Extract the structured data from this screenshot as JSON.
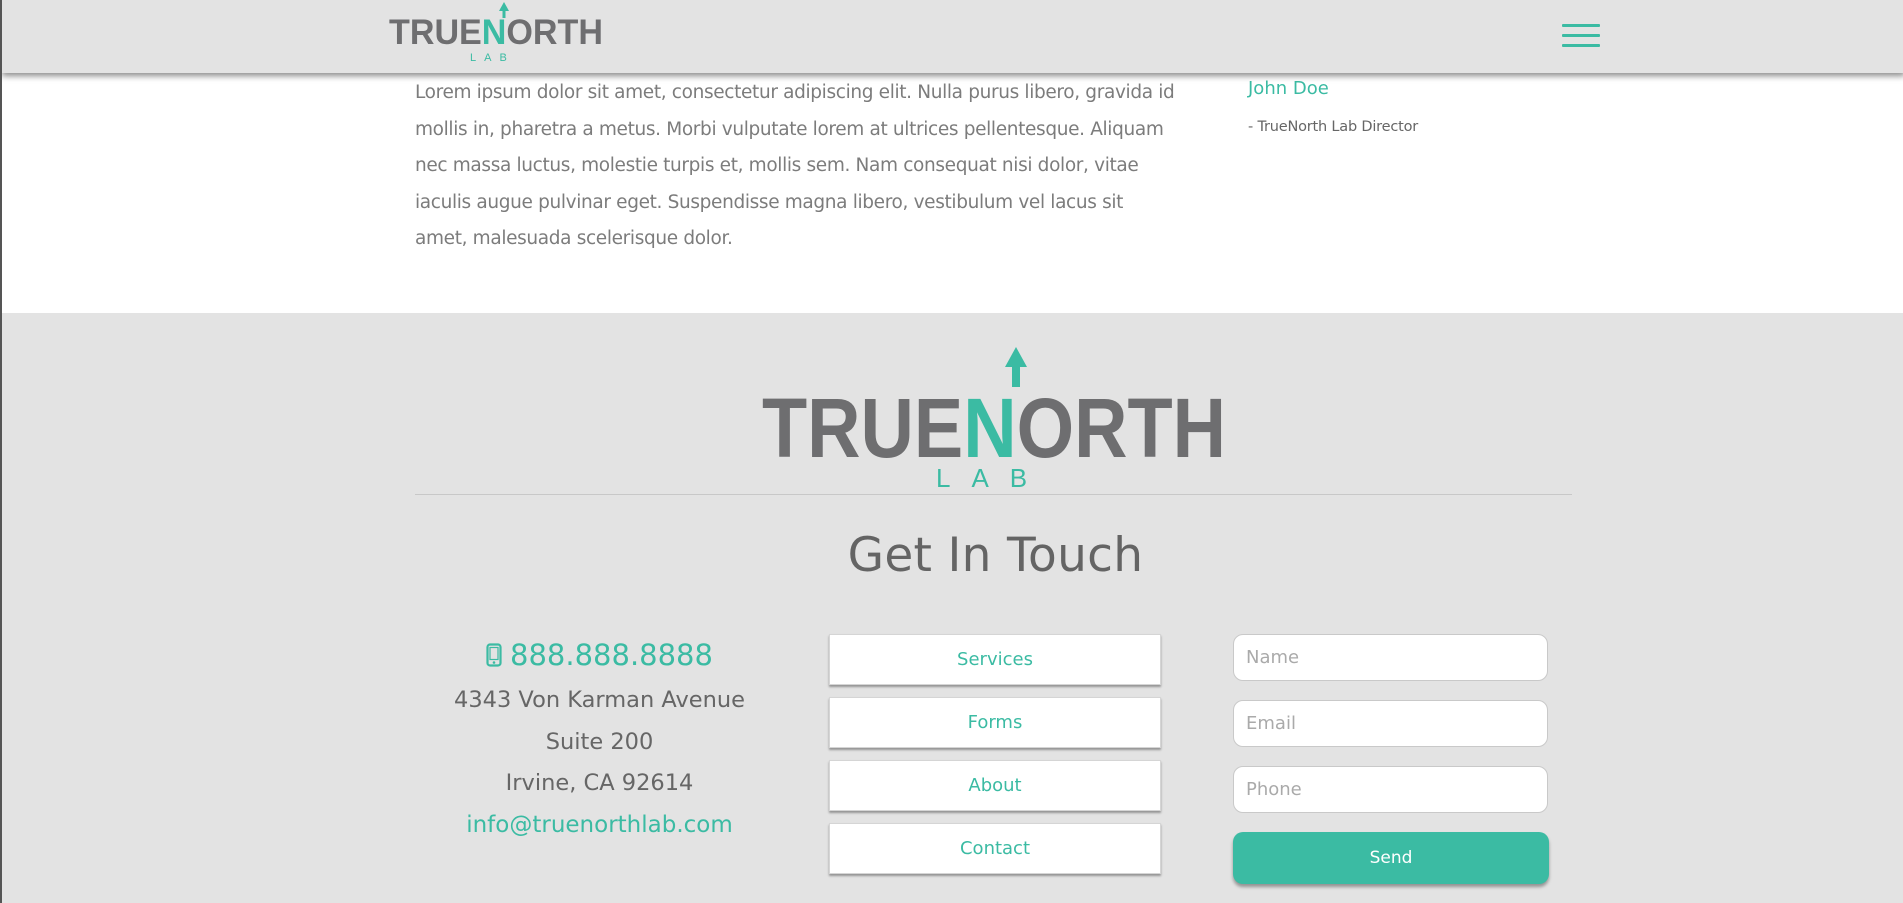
{
  "header": {
    "logo": {
      "word": "TRUENORTH",
      "sub": "LAB"
    },
    "menu_icon": "hamburger-menu-icon"
  },
  "content": {
    "paragraph": "Lorem ipsum dolor sit amet, consectetur adipiscing elit. Nulla purus libero, gravida id mollis in, pharetra a metus. Morbi vulputate lorem at ultrices pellentesque. Aliquam nec massa luctus, molestie turpis et, mollis sem. Nam consequat nisi dolor, vitae iaculis augue pulvinar eget. Suspendisse magna libero, vestibulum vel lacus sit amet, malesuada scelerisque dolor.",
    "quote_name": "John Doe",
    "quote_role": "- TrueNorth Lab Director"
  },
  "footer": {
    "logo": {
      "word": "TRUENORTH",
      "sub": "LAB"
    },
    "title": "Get In Touch",
    "contact": {
      "phone": "888.888.8888",
      "phone_icon": "mobile-phone-icon",
      "address_line1": "4343 Von Karman Avenue",
      "address_line2": "Suite 200",
      "address_line3": "Irvine, CA 92614",
      "email": "info@truenorthlab.com"
    },
    "nav": [
      {
        "label": "Services"
      },
      {
        "label": "Forms"
      },
      {
        "label": "About"
      },
      {
        "label": "Contact"
      }
    ],
    "form": {
      "name_placeholder": "Name",
      "email_placeholder": "Email",
      "phone_placeholder": "Phone",
      "send_label": "Send"
    }
  },
  "colors": {
    "accent": "#3bbba3",
    "logo_gray": "#6e6e70",
    "footer_bg": "#e3e3e3",
    "text_gray": "#7c7c7c"
  }
}
